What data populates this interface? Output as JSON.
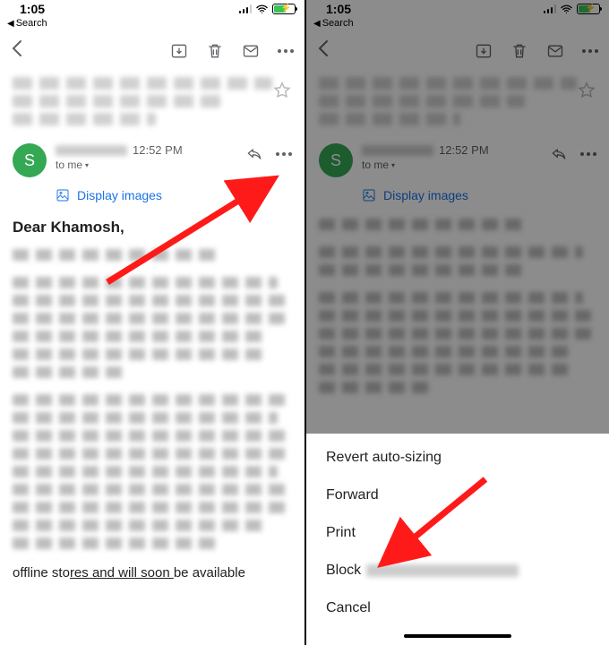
{
  "status": {
    "time": "1:05",
    "back_label": "Search"
  },
  "toolbar": {},
  "sender": {
    "avatar_initial": "S",
    "timestamp": "12:52 PM",
    "to_line": "to me",
    "display_images": "Display images"
  },
  "body": {
    "greeting": "Dear Khamosh,",
    "tail_pre": "offline sto",
    "tail_underlined": "res and will soon ",
    "tail_post": "be available"
  },
  "sheet": {
    "items": [
      "Revert auto-sizing",
      "Forward",
      "Print",
      "Block",
      "Cancel"
    ]
  }
}
